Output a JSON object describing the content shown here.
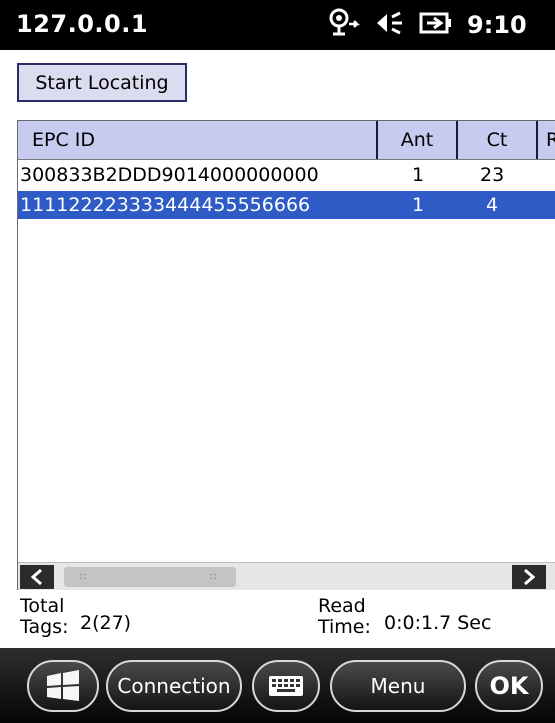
{
  "status_bar": {
    "title": "127.0.0.1",
    "time": "9:10",
    "icons": [
      "wireless-sync-icon",
      "speaker-icon",
      "battery-charging-icon"
    ]
  },
  "actions": {
    "start_label": "Start Locating"
  },
  "table": {
    "columns": [
      "EPC ID",
      "Ant",
      "Ct",
      "R"
    ],
    "rows": [
      {
        "epc": "300833B2DDD9014000000000",
        "ant": "1",
        "ct": "23",
        "selected": false
      },
      {
        "epc": "111122223333444455556666",
        "ant": "1",
        "ct": "4",
        "selected": true
      }
    ],
    "selection_color": "#2e5bc6"
  },
  "summary": {
    "total_label_1": "Total",
    "total_label_2": "Tags:",
    "total_value": "2(27)",
    "read_label_1": "Read",
    "read_label_2": "Time:",
    "read_value": "0:0:1.7 Sec"
  },
  "taskbar": {
    "connection_label": "Connection",
    "menu_label": "Menu",
    "ok_label": "OK",
    "icons": [
      "windows-start-icon",
      "keyboard-icon"
    ]
  }
}
